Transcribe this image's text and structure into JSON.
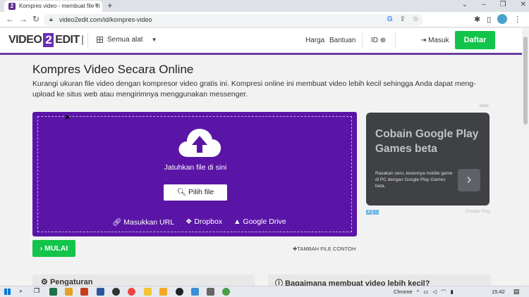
{
  "browser": {
    "tab_title": "Kompres video - membuat file vi",
    "tab_favicon": "2",
    "url": "video2edit.com/id/kompres-video",
    "window_controls": [
      "⌄",
      "–",
      "❐",
      "✕"
    ]
  },
  "header": {
    "logo_left": "VIDEO",
    "logo_mid": "2",
    "logo_right": "EDIT",
    "tools_label": "Semua alat",
    "nav": [
      "Harga",
      "Bantuan"
    ],
    "lang": "ID",
    "login": "Masuk",
    "signup": "Daftar",
    "accent_color": "#6a3fa0",
    "cta_color": "#12c449"
  },
  "main": {
    "title": "Kompres Video Secara Online",
    "description": "Kurangi ukuran file video dengan kompresor video gratis ini. Kompresi online ini membuat video lebih kecil sehingga Anda dapat meng-upload ke situs web atau mengirimnya menggunakan messenger.",
    "drop_text": "Jatuhkan file di sini",
    "pick_button": "Pilih file",
    "sources": [
      "Masukkan URL",
      "Dropbox",
      "Google Drive"
    ],
    "start_button": "MULAI",
    "add_sample": "TAMBAH FILE CONTOH",
    "upload_color": "#5a15a6"
  },
  "ad": {
    "label": "Iklan",
    "title": "Cobain Google Play Games beta",
    "body": "Rasakan seru, kerennya mobile game di PC dengan Google Play Games beta.",
    "footer": "Google Play"
  },
  "cards": {
    "settings": "Pengaturan",
    "howto": "Bagaimana membuat video lebih kecil?"
  },
  "taskbar": {
    "browser_label": "Chrome",
    "time": "15:42"
  }
}
